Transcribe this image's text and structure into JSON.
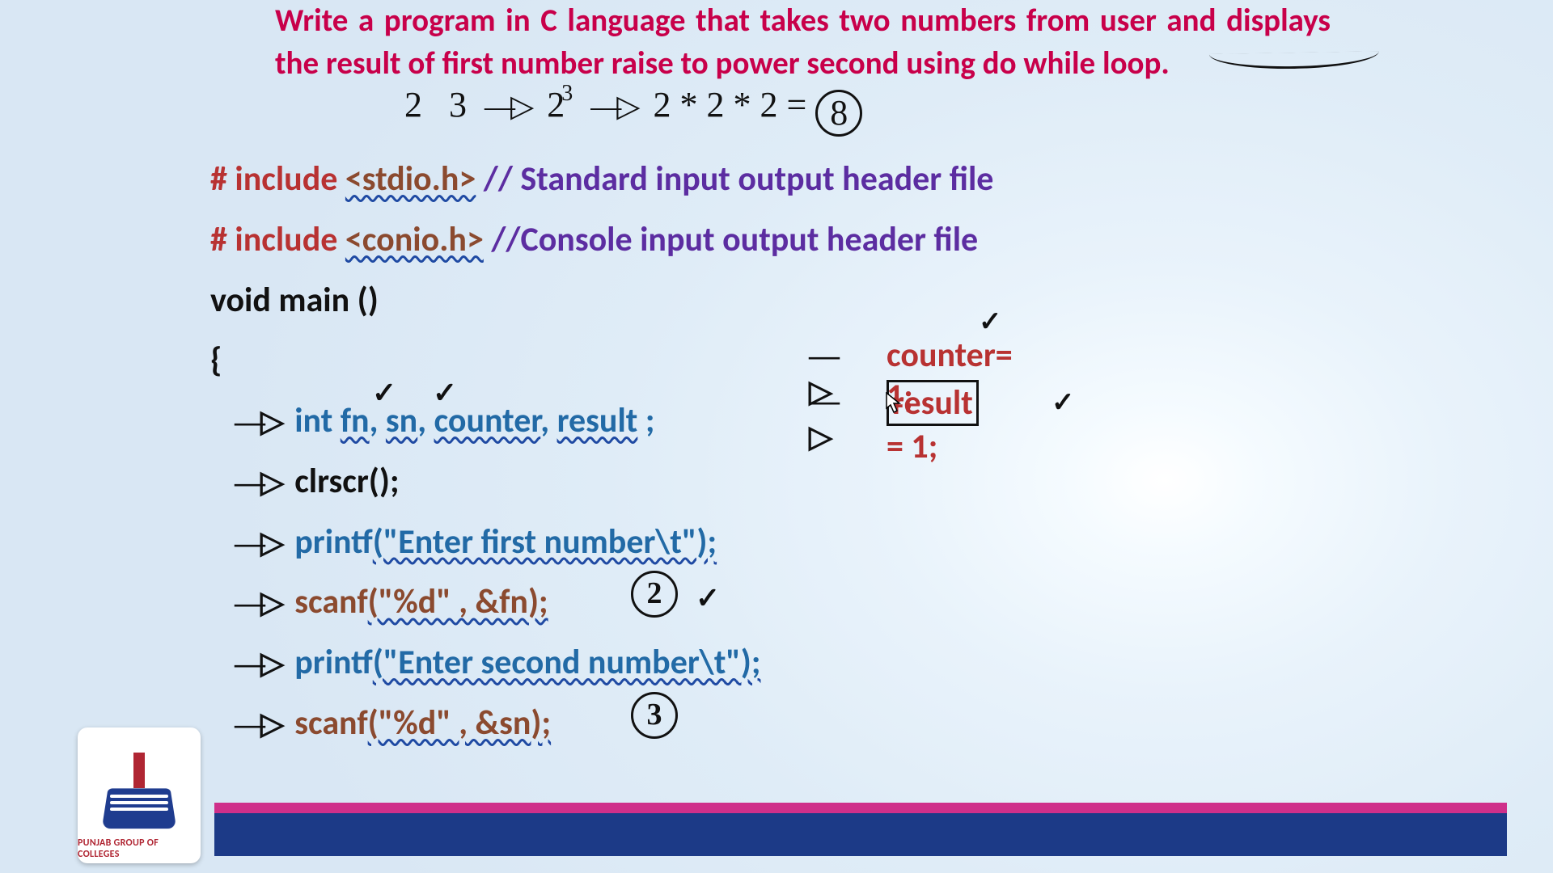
{
  "problem": "Write a program in C language that takes two numbers from user and displays the result of first number raise to power second using do while loop.",
  "example": {
    "a": "2",
    "b": "3",
    "mid_expr": "2",
    "mid_sup": "3",
    "expand": "2 * 2 * 2 =",
    "ans": "8"
  },
  "code": {
    "inc1_hash": "# include",
    "inc1_lib": "<stdio.h>",
    "inc1_comment": "// Standard input output header file",
    "inc2_hash": "# include",
    "inc2_lib": "<conio.h>",
    "inc2_comment": "//Console input output header file",
    "main": "void main ()",
    "brace_open": "{",
    "decl_kw": "int",
    "decl_v1": "fn",
    "decl_v2": "sn",
    "decl_v3": "counter",
    "decl_v4": "result",
    "decl_semi": " ;",
    "clrscr": "clrscr();",
    "p1_fn": "printf",
    "p1_arg": "(\"Enter first number\\t\");",
    "s1_fn": "scanf",
    "s1_arg": "(\"%d\" , &fn);",
    "p2_fn": "printf",
    "p2_arg": "(\"Enter second number\\t\");",
    "s2_fn": "scanf",
    "s2_arg": "(\"%d\" , &sn);"
  },
  "side": {
    "l1": "counter= 1;",
    "l2a": "result",
    "l2b": "= 1;"
  },
  "annot": {
    "circ1": "2",
    "circ2": "3",
    "tick": "✓"
  },
  "logo": {
    "text": "PUNJAB GROUP OF COLLEGES"
  }
}
